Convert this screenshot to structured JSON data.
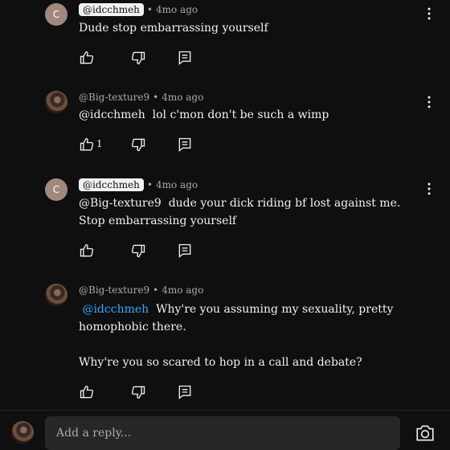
{
  "comments": [
    {
      "avatar_letter": "C",
      "author": "@idcchmeh",
      "time": "4mo ago",
      "mention": "",
      "text": "Dude stop embarrassing yourself",
      "likes": ""
    },
    {
      "avatar_letter": "",
      "author": "@Big-texture9",
      "time": "4mo ago",
      "mention": "@idcchmeh",
      "text": "lol c'mon don't be such a wimp",
      "likes": "1"
    },
    {
      "avatar_letter": "C",
      "author": "@idcchmeh",
      "time": "4mo ago",
      "mention": "@Big-texture9",
      "text": "dude your dick riding bf lost against me. Stop embarrassing yourself",
      "likes": ""
    },
    {
      "avatar_letter": "",
      "author": "@Big-texture9",
      "time": "4mo ago",
      "mention": "@idcchmeh",
      "text_line1": "Why're you assuming my sexuality, pretty homophobic there.",
      "text_line2": "Why're you so scared to hop in a call and debate?",
      "likes": ""
    }
  ],
  "separator": "•",
  "reply_placeholder": "Add a reply...",
  "icons": {
    "like": "thumb-up-icon",
    "dislike": "thumb-down-icon",
    "reply": "reply-icon",
    "more": "kebab-menu-icon",
    "camera": "camera-icon"
  },
  "colors": {
    "background": "#0f0f0f",
    "text": "#f1f1f1",
    "secondary_text": "#aaaaaa",
    "mention": "#3ea6ff",
    "input_bg": "#272727"
  }
}
